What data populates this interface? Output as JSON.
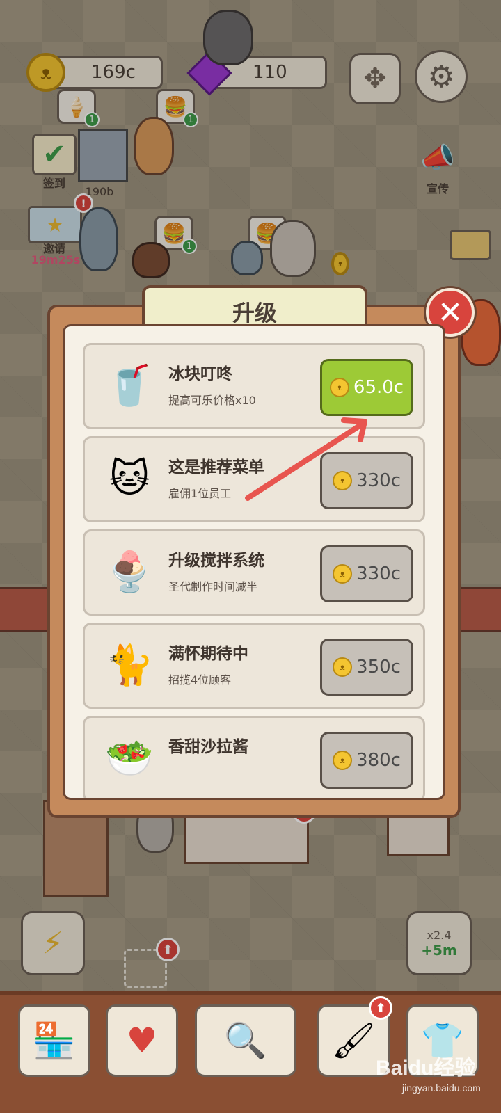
{
  "hud": {
    "coins": "169c",
    "gems": "110",
    "coin_glyph": "ᴥ",
    "move_icon": "move-arrows-icon",
    "settings_icon": "gear-icon"
  },
  "side_left": {
    "checkin_label": "签到",
    "invite_label": "邀请",
    "invite_timer": "19m25s"
  },
  "side_right": {
    "promote_label": "宣传"
  },
  "scene": {
    "price_tag": "190b",
    "boost_multiplier": "x2.4",
    "boost_time": "+5m"
  },
  "dialog": {
    "title": "升级",
    "close_symbol": "✕",
    "upgrades": [
      {
        "icon": "🥤",
        "icon_name": "cola-cup-icon",
        "title": "冰块叮咚",
        "desc": "提高可乐价格x10",
        "price": "65.0c",
        "affordable": true
      },
      {
        "icon": "🐱",
        "icon_name": "chef-cat-icon",
        "title": "这是推荐菜单",
        "desc": "雇佣1位员工",
        "price": "330c",
        "affordable": false
      },
      {
        "icon": "🍨",
        "icon_name": "milkshake-icon",
        "title": "升级搅拌系统",
        "desc": "圣代制作时间减半",
        "price": "330c",
        "affordable": false
      },
      {
        "icon": "🐈",
        "icon_name": "calico-cat-icon",
        "title": "满怀期待中",
        "desc": "招揽4位顾客",
        "price": "350c",
        "affordable": false
      },
      {
        "icon": "🥗",
        "icon_name": "salad-icon",
        "title": "香甜沙拉酱",
        "desc": "",
        "price": "380c",
        "affordable": false
      }
    ]
  },
  "bottom_bar": {
    "items": [
      "shop-icon",
      "heart-paw-icon",
      "newspaper-search-icon",
      "paint-roller-icon",
      "tshirt-icon"
    ]
  },
  "watermark": {
    "brand": "Baidu经验",
    "site": "jingyan.baidu.com"
  },
  "colors": {
    "accent_green": "#9dca36",
    "close_red": "#d8443d",
    "frame_brown": "#c58a5c"
  }
}
